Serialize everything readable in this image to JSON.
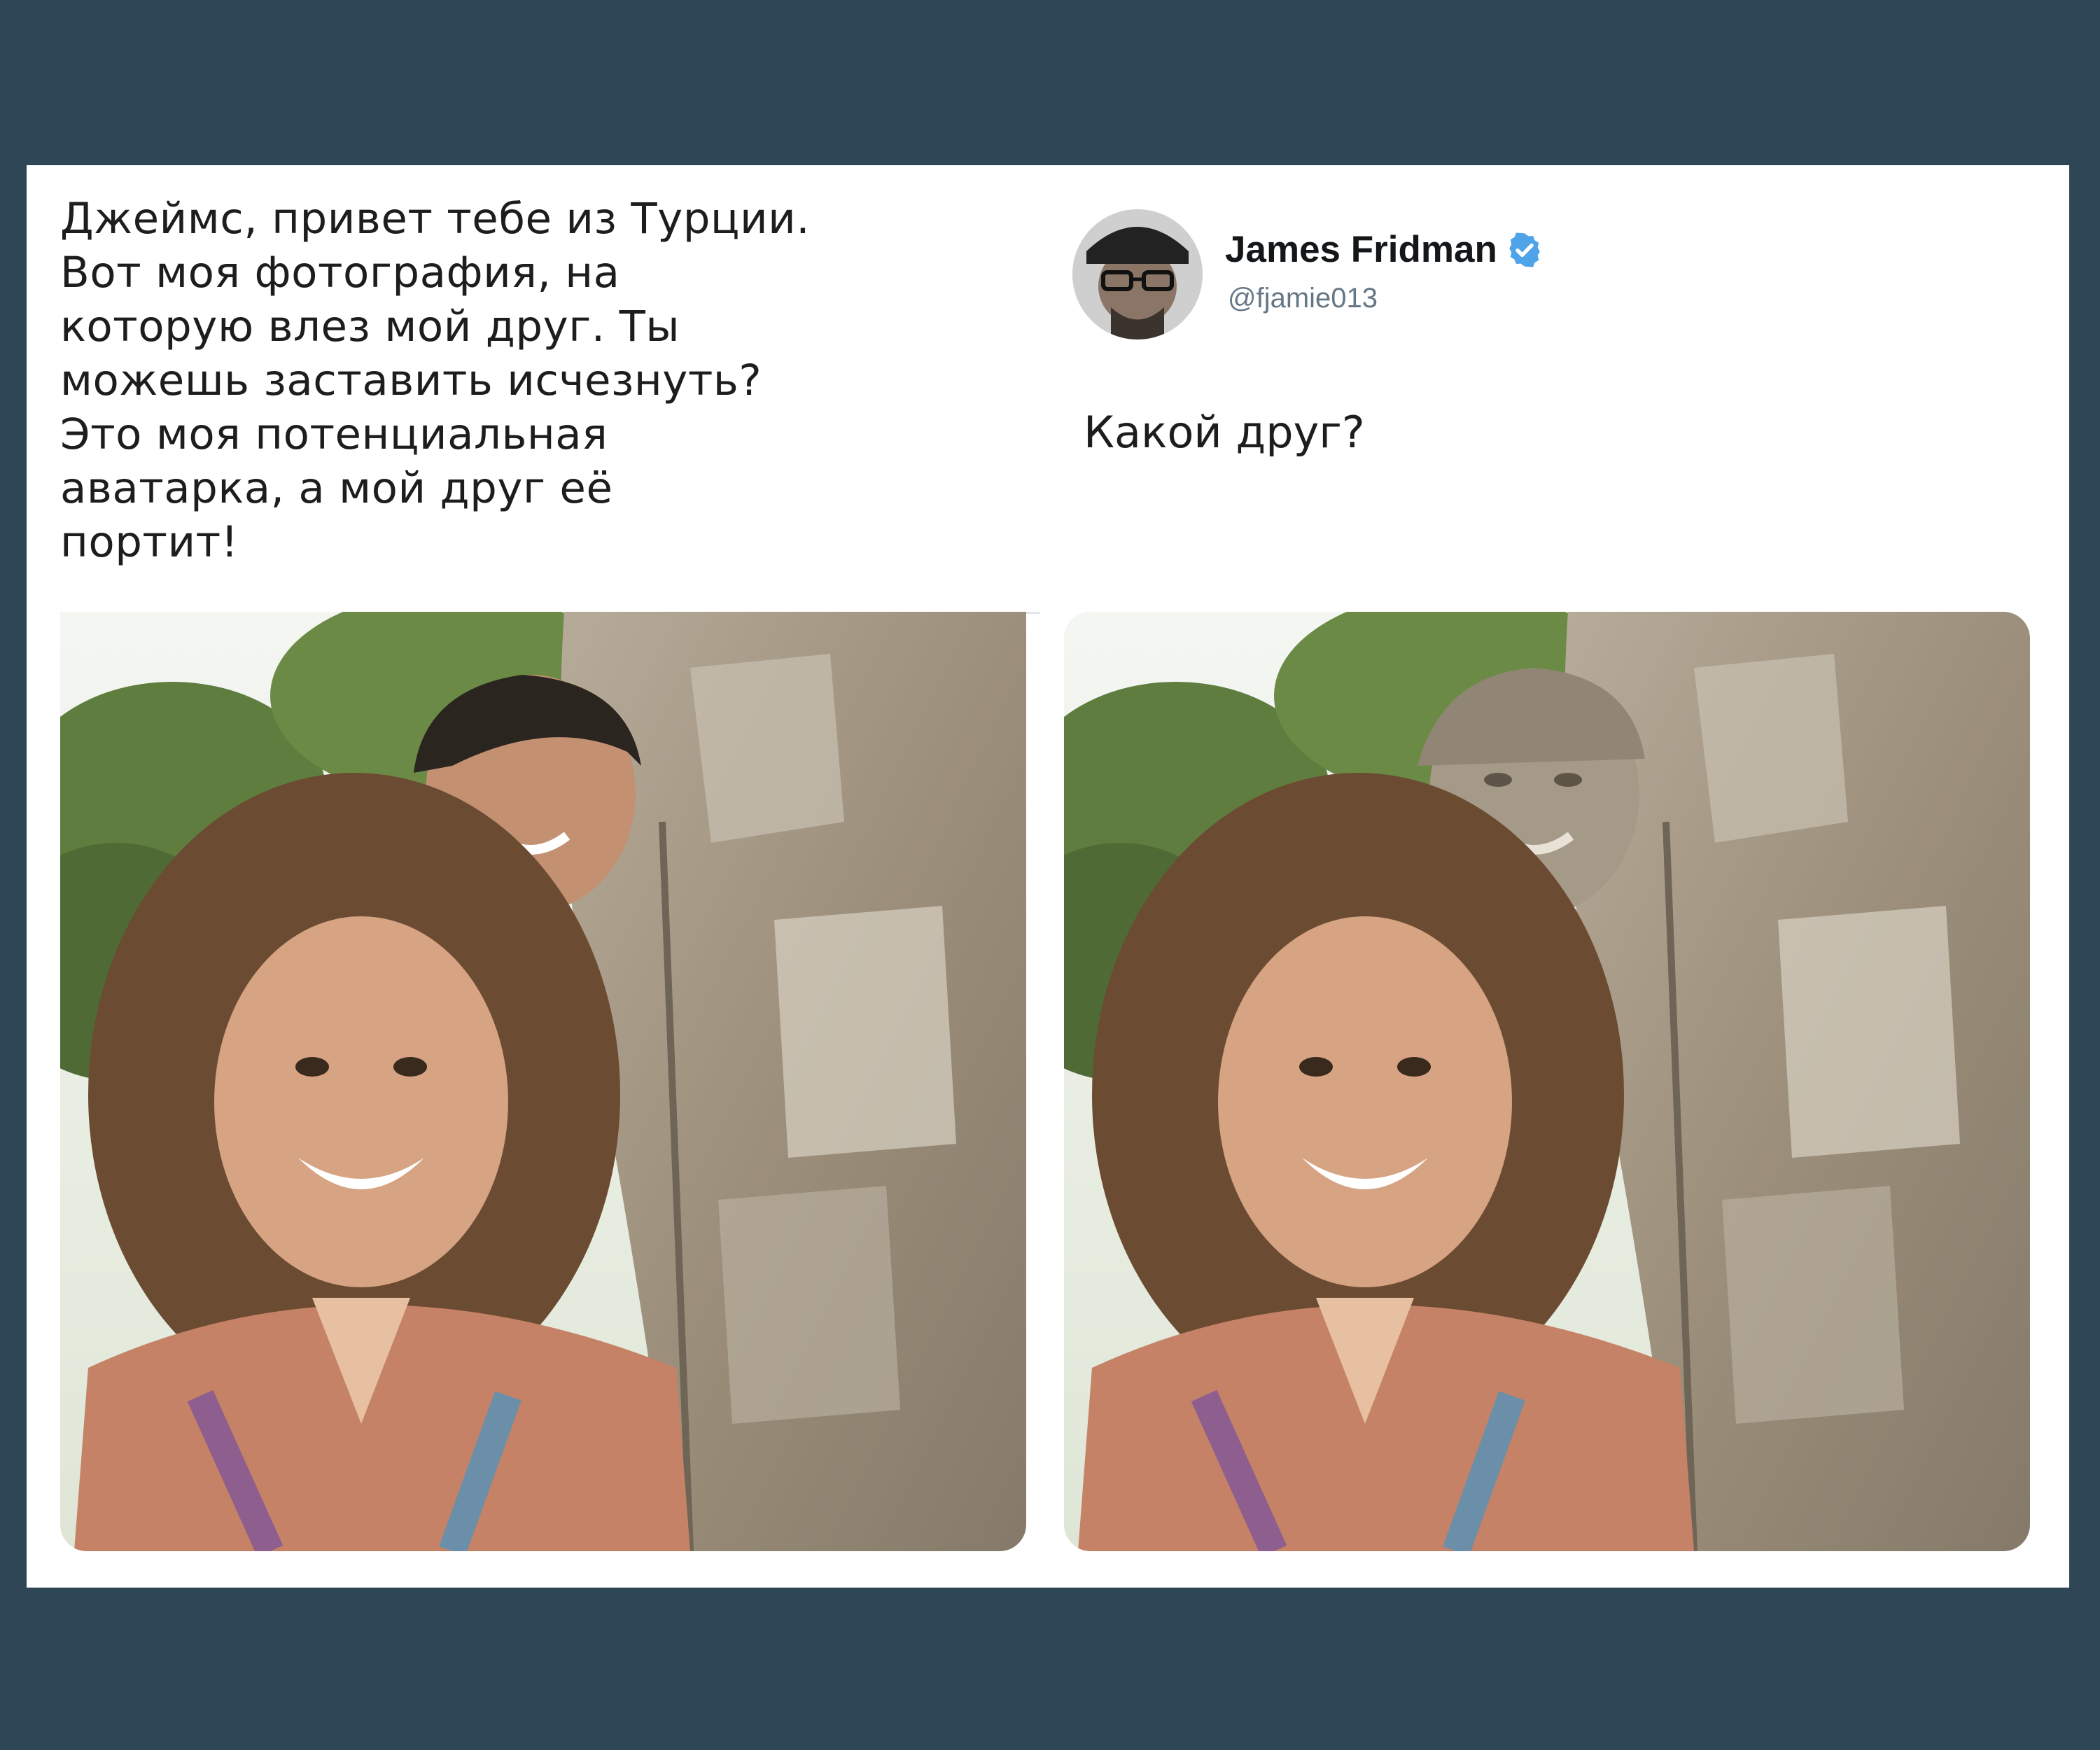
{
  "request": {
    "text": "Джеймс, привет тебе из Турции.\nВот моя фотография, на\nкоторую влез мой друг. Ты\nможешь заставить исчезнуть?\nЭто моя потенциальная\nаватарка, а мой друг её\nпортит!"
  },
  "reply": {
    "display_name": "James Fridman",
    "handle": "@fjamie013",
    "text": "Какой друг?",
    "avatar_icon": "user-avatar-photo",
    "verified_icon": "verified-badge-icon"
  },
  "colors": {
    "background": "#2f4656",
    "card": "#ffffff",
    "verified": "#4fa3e8",
    "handle": "#657786"
  }
}
